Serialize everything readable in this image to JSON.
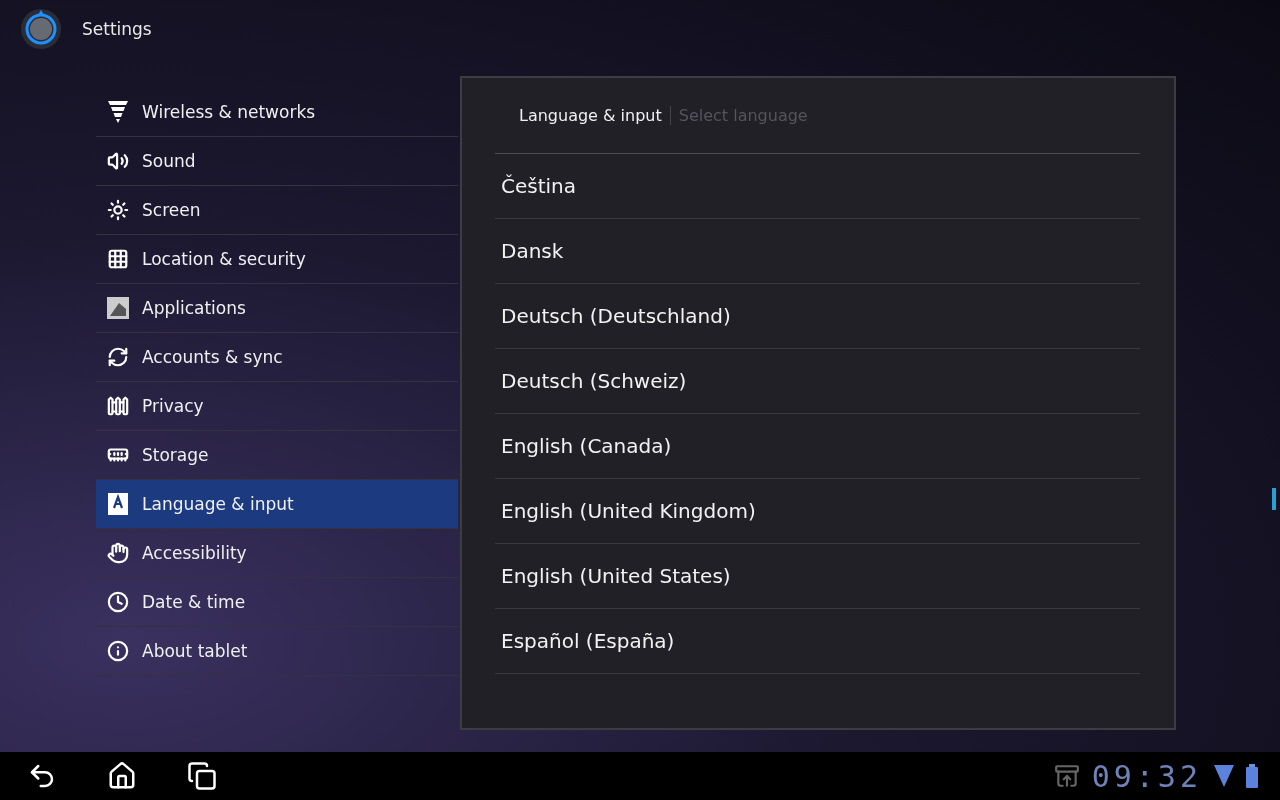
{
  "action_bar": {
    "title": "Settings"
  },
  "sidebar": {
    "items": [
      {
        "label": "Wireless & networks",
        "selected": false
      },
      {
        "label": "Sound",
        "selected": false
      },
      {
        "label": "Screen",
        "selected": false
      },
      {
        "label": "Location & security",
        "selected": false
      },
      {
        "label": "Applications",
        "selected": false
      },
      {
        "label": "Accounts & sync",
        "selected": false
      },
      {
        "label": "Privacy",
        "selected": false
      },
      {
        "label": "Storage",
        "selected": false
      },
      {
        "label": "Language & input",
        "selected": true
      },
      {
        "label": "Accessibility",
        "selected": false
      },
      {
        "label": "Date & time",
        "selected": false
      },
      {
        "label": "About tablet",
        "selected": false
      }
    ]
  },
  "dialog": {
    "breadcrumb": "Language & input",
    "subtitle": "Select language",
    "languages": [
      "Čeština",
      "Dansk",
      "Deutsch (Deutschland)",
      "Deutsch (Schweiz)",
      "English (Canada)",
      "English (United Kingdom)",
      "English (United States)",
      "Español (España)"
    ]
  },
  "status_bar": {
    "clock": "09:32"
  }
}
